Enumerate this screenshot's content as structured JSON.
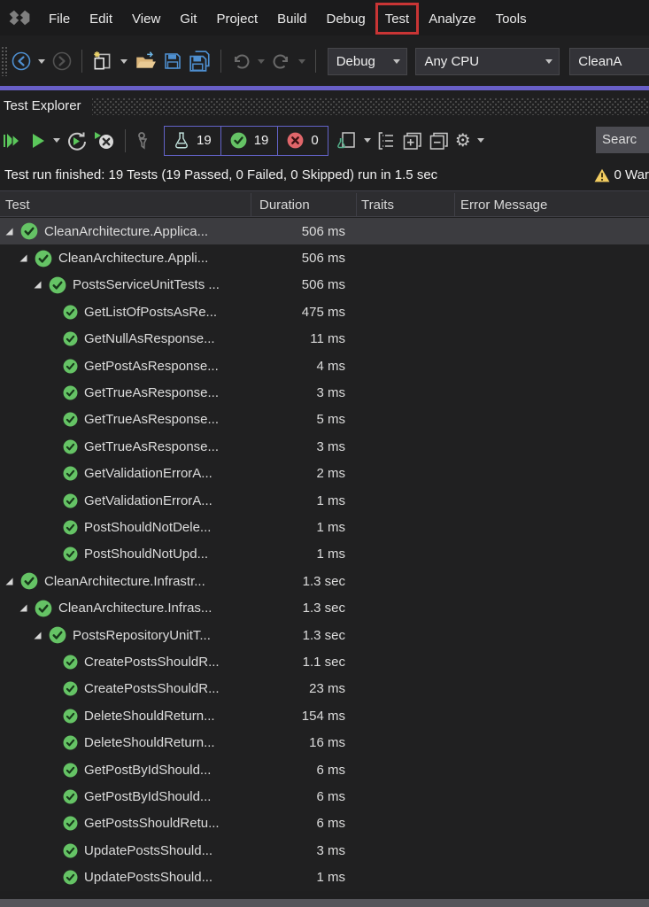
{
  "menu_bar": {
    "items": [
      "File",
      "Edit",
      "View",
      "Git",
      "Project",
      "Build",
      "Debug",
      "Test",
      "Analyze",
      "Tools"
    ],
    "highlighted_item": "Test"
  },
  "main_toolbar": {
    "configuration": "Debug",
    "platform": "Any CPU",
    "startup_project": "CleanA"
  },
  "panel": {
    "title": "Test Explorer"
  },
  "test_explorer_toolbar": {
    "total_count": "19",
    "passed_count": "19",
    "failed_count": "0",
    "search_text": "Searc"
  },
  "status": {
    "message": "Test run finished: 19 Tests (19 Passed, 0 Failed, 0 Skipped) run in 1.5 sec",
    "warning_text": "0 War"
  },
  "grid": {
    "columns": [
      "Test",
      "Duration",
      "Traits",
      "Error Message"
    ]
  },
  "icons": {
    "gear_glyph": "⚙"
  },
  "colors": {
    "accent_purple": "#685fc7",
    "pass_green": "#65c365",
    "fail_red": "#e0666a",
    "highlight_red": "#c93535",
    "warning_yellow": "#f2cc60"
  },
  "tree": {
    "rows": [
      {
        "level": 1,
        "label": "CleanArchitecture.Applica...",
        "duration": "506 ms",
        "selected": true
      },
      {
        "level": 2,
        "label": "CleanArchitecture.Appli...",
        "duration": "506 ms"
      },
      {
        "level": 3,
        "label": "PostsServiceUnitTests ...",
        "duration": "506 ms"
      },
      {
        "level": 4,
        "label": "GetListOfPostsAsRe...",
        "duration": "475 ms"
      },
      {
        "level": 4,
        "label": "GetNullAsResponse...",
        "duration": "11 ms"
      },
      {
        "level": 4,
        "label": "GetPostAsResponse...",
        "duration": "4 ms"
      },
      {
        "level": 4,
        "label": "GetTrueAsResponse...",
        "duration": "3 ms"
      },
      {
        "level": 4,
        "label": "GetTrueAsResponse...",
        "duration": "5 ms"
      },
      {
        "level": 4,
        "label": "GetTrueAsResponse...",
        "duration": "3 ms"
      },
      {
        "level": 4,
        "label": "GetValidationErrorA...",
        "duration": "2 ms"
      },
      {
        "level": 4,
        "label": "GetValidationErrorA...",
        "duration": "1 ms"
      },
      {
        "level": 4,
        "label": "PostShouldNotDele...",
        "duration": "1 ms"
      },
      {
        "level": 4,
        "label": "PostShouldNotUpd...",
        "duration": "1 ms"
      },
      {
        "level": 1,
        "label": "CleanArchitecture.Infrastr...",
        "duration": "1.3 sec"
      },
      {
        "level": 2,
        "label": "CleanArchitecture.Infras...",
        "duration": "1.3 sec"
      },
      {
        "level": 3,
        "label": "PostsRepositoryUnitT...",
        "duration": "1.3 sec"
      },
      {
        "level": 4,
        "label": "CreatePostsShouldR...",
        "duration": "1.1 sec"
      },
      {
        "level": 4,
        "label": "CreatePostsShouldR...",
        "duration": "23 ms"
      },
      {
        "level": 4,
        "label": "DeleteShouldReturn...",
        "duration": "154 ms"
      },
      {
        "level": 4,
        "label": "DeleteShouldReturn...",
        "duration": "16 ms"
      },
      {
        "level": 4,
        "label": "GetPostByIdShould...",
        "duration": "6 ms"
      },
      {
        "level": 4,
        "label": "GetPostByIdShould...",
        "duration": "6 ms"
      },
      {
        "level": 4,
        "label": "GetPostsShouldRetu...",
        "duration": "6 ms"
      },
      {
        "level": 4,
        "label": "UpdatePostsShould...",
        "duration": "3 ms"
      },
      {
        "level": 4,
        "label": "UpdatePostsShould...",
        "duration": "1 ms"
      }
    ]
  }
}
